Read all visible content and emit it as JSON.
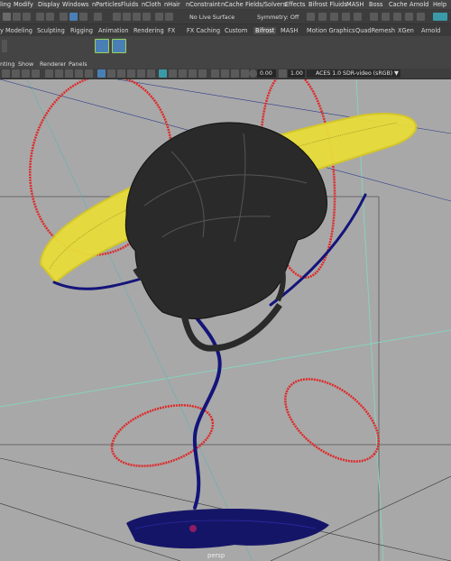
{
  "menubar": {
    "items": [
      "ling",
      "Modify",
      "Display",
      "Windows",
      "nParticles",
      "Fluids",
      "nCloth",
      "nHair",
      "nConstraint",
      "nCache",
      "Fields/Solvers",
      "Effects",
      "Bifrost Fluids",
      "MASH",
      "Boss",
      "Cache",
      "Arnold",
      "Help"
    ]
  },
  "statusline": {
    "live_surface": "No Live Surface",
    "symmetry": "Symmetry: Off"
  },
  "shelf": {
    "tabs": [
      "y Modeling",
      "Sculpting",
      "Rigging",
      "Animation",
      "Rendering",
      "FX",
      "FX Caching",
      "Custom",
      "Bifrost",
      "MASH",
      "Motion Graphics",
      "QuadRemesh",
      "XGen",
      "Arnold"
    ],
    "active_tab": "Bifrost"
  },
  "panel_menu": {
    "items": [
      "nting",
      "Show",
      "Renderer",
      "Panels"
    ]
  },
  "panel_toolbar": {
    "exposure": "0.00",
    "gamma": "1.00",
    "color_space": "ACES 1.0 SDR-video (sRGB)"
  },
  "viewport": {
    "camera": "persp"
  },
  "colors": {
    "viewport_bg": "#a8a8a8",
    "helmet": "#2a2a2a",
    "ring_yellow": "#e8dc3a",
    "ring_red": "#e02828",
    "ribbon_blue": "#14147a",
    "grid_line": "#9ad6c8"
  }
}
